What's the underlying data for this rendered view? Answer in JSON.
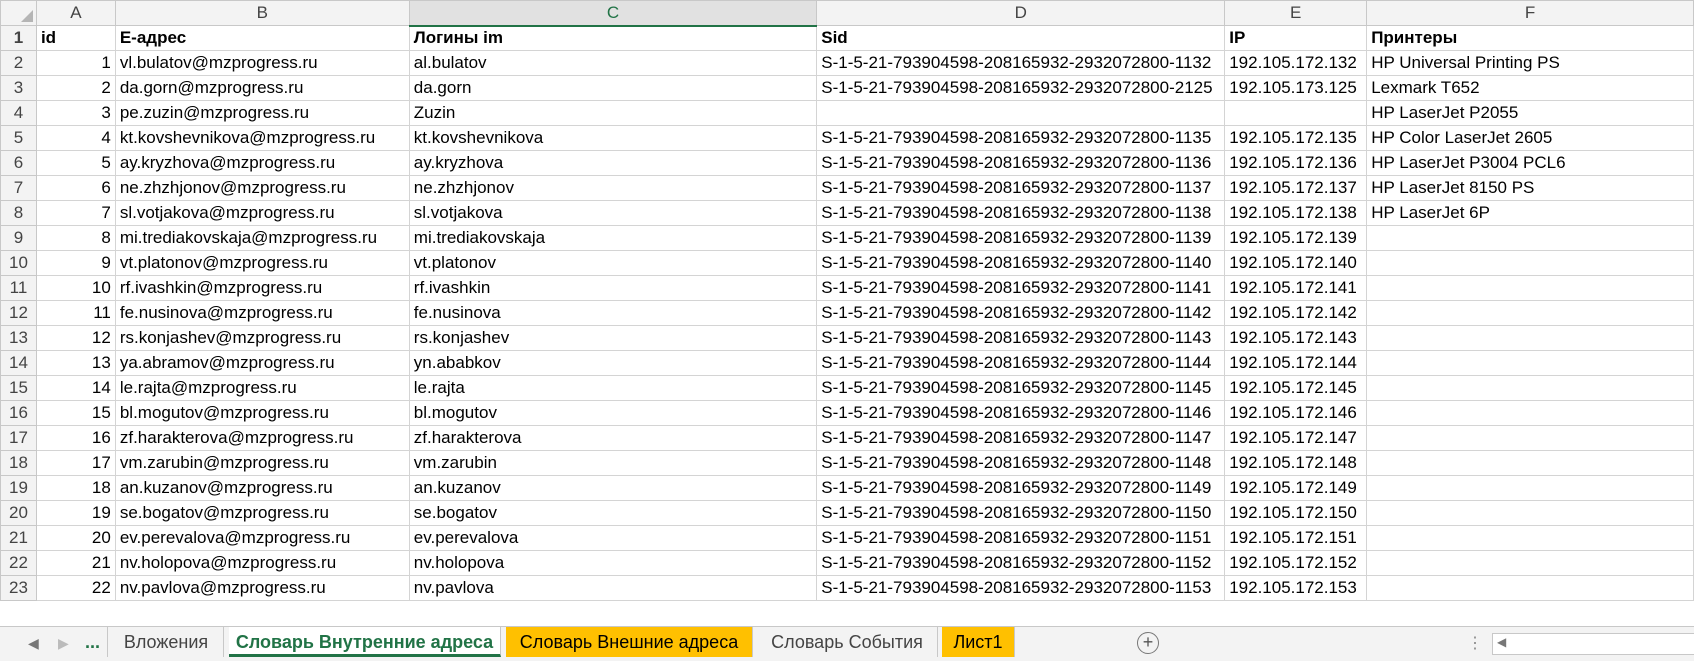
{
  "columns": [
    "A",
    "B",
    "C",
    "D",
    "E",
    "F"
  ],
  "selected_column": "C",
  "rows": [
    {
      "n": "1",
      "cells": [
        "id",
        "E-адрес",
        "Логины im",
        "Sid",
        "IP",
        "Принтеры"
      ]
    },
    {
      "n": "2",
      "cells": [
        "1",
        "vl.bulatov@mzprogress.ru",
        "al.bulatov",
        "S-1-5-21-793904598-208165932-2932072800-1132",
        "192.105.172.132",
        "HP Universal Printing PS"
      ]
    },
    {
      "n": "3",
      "cells": [
        "2",
        "da.gorn@mzprogress.ru",
        "da.gorn",
        "S-1-5-21-793904598-208165932-2932072800-2125",
        "192.105.173.125",
        "Lexmark T652"
      ]
    },
    {
      "n": "4",
      "cells": [
        "3",
        "pe.zuzin@mzprogress.ru",
        "Zuzin",
        "",
        "",
        "HP LaserJet P2055"
      ]
    },
    {
      "n": "5",
      "cells": [
        "4",
        "kt.kovshevnikova@mzprogress.ru",
        "kt.kovshevnikova",
        "S-1-5-21-793904598-208165932-2932072800-1135",
        "192.105.172.135",
        "HP Color LaserJet 2605"
      ]
    },
    {
      "n": "6",
      "cells": [
        "5",
        "ay.kryzhova@mzprogress.ru",
        "ay.kryzhova",
        "S-1-5-21-793904598-208165932-2932072800-1136",
        "192.105.172.136",
        "HP LaserJet P3004 PCL6"
      ]
    },
    {
      "n": "7",
      "cells": [
        "6",
        "ne.zhzhjonov@mzprogress.ru",
        "ne.zhzhjonov",
        "S-1-5-21-793904598-208165932-2932072800-1137",
        "192.105.172.137",
        "HP LaserJet 8150 PS"
      ]
    },
    {
      "n": "8",
      "cells": [
        "7",
        "sl.votjakova@mzprogress.ru",
        "sl.votjakova",
        "S-1-5-21-793904598-208165932-2932072800-1138",
        "192.105.172.138",
        "HP LaserJet 6P"
      ]
    },
    {
      "n": "9",
      "cells": [
        "8",
        "mi.trediakovskaja@mzprogress.ru",
        "mi.trediakovskaja",
        "S-1-5-21-793904598-208165932-2932072800-1139",
        "192.105.172.139",
        ""
      ]
    },
    {
      "n": "10",
      "cells": [
        "9",
        "vt.platonov@mzprogress.ru",
        "vt.platonov",
        "S-1-5-21-793904598-208165932-2932072800-1140",
        "192.105.172.140",
        ""
      ]
    },
    {
      "n": "11",
      "cells": [
        "10",
        "rf.ivashkin@mzprogress.ru",
        "rf.ivashkin",
        "S-1-5-21-793904598-208165932-2932072800-1141",
        "192.105.172.141",
        ""
      ]
    },
    {
      "n": "12",
      "cells": [
        "11",
        "fe.nusinova@mzprogress.ru",
        "fe.nusinova",
        "S-1-5-21-793904598-208165932-2932072800-1142",
        "192.105.172.142",
        ""
      ]
    },
    {
      "n": "13",
      "cells": [
        "12",
        "rs.konjashev@mzprogress.ru",
        "rs.konjashev",
        "S-1-5-21-793904598-208165932-2932072800-1143",
        "192.105.172.143",
        ""
      ]
    },
    {
      "n": "14",
      "cells": [
        "13",
        "ya.abramov@mzprogress.ru",
        "yn.ababkov",
        "S-1-5-21-793904598-208165932-2932072800-1144",
        "192.105.172.144",
        ""
      ]
    },
    {
      "n": "15",
      "cells": [
        "14",
        "le.rajta@mzprogress.ru",
        "le.rajta",
        "S-1-5-21-793904598-208165932-2932072800-1145",
        "192.105.172.145",
        ""
      ]
    },
    {
      "n": "16",
      "cells": [
        "15",
        "bl.mogutov@mzprogress.ru",
        "bl.mogutov",
        "S-1-5-21-793904598-208165932-2932072800-1146",
        "192.105.172.146",
        ""
      ]
    },
    {
      "n": "17",
      "cells": [
        "16",
        "zf.harakterova@mzprogress.ru",
        "zf.harakterova",
        "S-1-5-21-793904598-208165932-2932072800-1147",
        "192.105.172.147",
        ""
      ]
    },
    {
      "n": "18",
      "cells": [
        "17",
        "vm.zarubin@mzprogress.ru",
        "vm.zarubin",
        "S-1-5-21-793904598-208165932-2932072800-1148",
        "192.105.172.148",
        ""
      ]
    },
    {
      "n": "19",
      "cells": [
        "18",
        "an.kuzanov@mzprogress.ru",
        "an.kuzanov",
        "S-1-5-21-793904598-208165932-2932072800-1149",
        "192.105.172.149",
        ""
      ]
    },
    {
      "n": "20",
      "cells": [
        "19",
        "se.bogatov@mzprogress.ru",
        "se.bogatov",
        "S-1-5-21-793904598-208165932-2932072800-1150",
        "192.105.172.150",
        ""
      ]
    },
    {
      "n": "21",
      "cells": [
        "20",
        "ev.perevalova@mzprogress.ru",
        "ev.perevalova",
        "S-1-5-21-793904598-208165932-2932072800-1151",
        "192.105.172.151",
        ""
      ]
    },
    {
      "n": "22",
      "cells": [
        "21",
        "nv.holopova@mzprogress.ru",
        "nv.holopova",
        "S-1-5-21-793904598-208165932-2932072800-1152",
        "192.105.172.152",
        ""
      ]
    },
    {
      "n": "23",
      "cells": [
        "22",
        "nv.pavlova@mzprogress.ru",
        "nv.pavlova",
        "S-1-5-21-793904598-208165932-2932072800-1153",
        "192.105.172.153",
        ""
      ]
    }
  ],
  "tabbar": {
    "more": "...",
    "tabs": [
      {
        "label": "Вложения",
        "style": "normal"
      },
      {
        "label": "Словарь Внутренние адреса",
        "style": "active"
      },
      {
        "label": "Словарь Внешние адреса",
        "style": "yellow"
      },
      {
        "label": "Словарь События",
        "style": "normal"
      },
      {
        "label": "Лист1",
        "style": "yellow"
      }
    ],
    "add_symbol": "+"
  },
  "colors": {
    "accent": "#217346",
    "tab_yellow": "#ffc000",
    "header_bg": "#f3f3f3"
  }
}
